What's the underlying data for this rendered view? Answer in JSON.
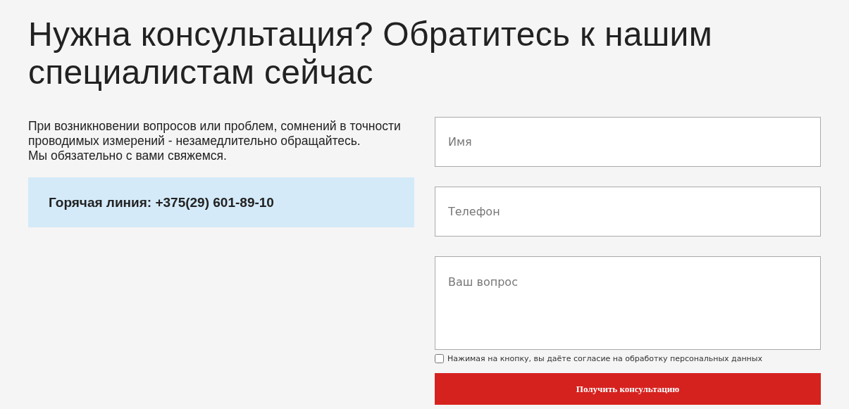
{
  "heading": "Нужна консультация? Обратитесь к нашим специалистам сейчас",
  "intro": [
    "При возникновении вопросов или проблем, сомнений в точности проводимых измерений - незамедлительно обращайтесь.",
    "Мы обязательно с вами свяжемся."
  ],
  "hotline": "Горячая линия: +375(29) 601-89-10",
  "form": {
    "fields": [
      {
        "kind": "input",
        "placeholder": "Имя"
      },
      {
        "kind": "input",
        "placeholder": "Телефон"
      },
      {
        "kind": "textarea",
        "placeholder": "Ваш вопрос"
      }
    ],
    "consent": {
      "label": "Нажимая на кнопку, вы даёте согласие на обработку персональных данных",
      "checked": false
    },
    "submit": "Получить консультацию"
  }
}
